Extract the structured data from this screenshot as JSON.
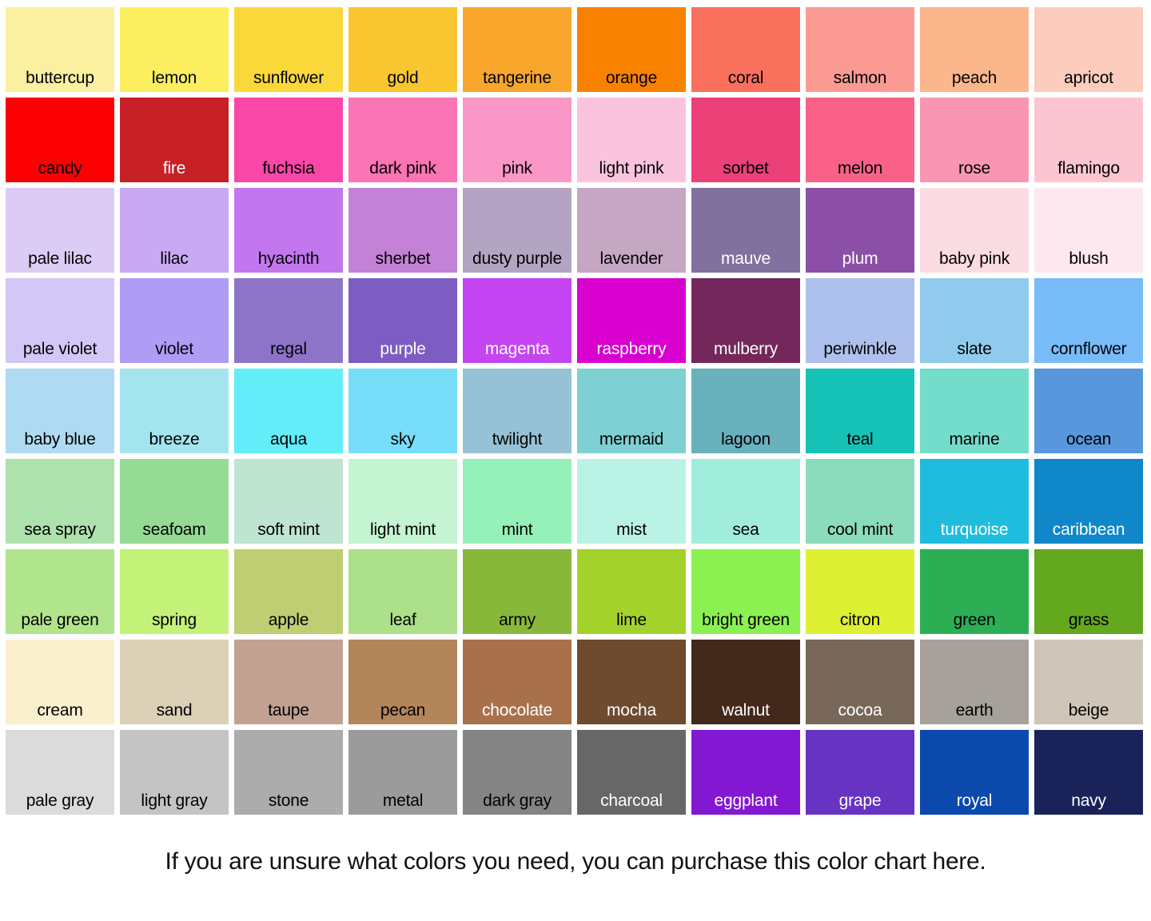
{
  "caption": "If you are unsure what colors you need, you can purchase this color chart here.",
  "grid": {
    "columns": 10,
    "rows": 9,
    "total_swatches": 90
  },
  "chart_data": {
    "type": "table",
    "title": "Color Chart",
    "columns": 10,
    "rows": 9,
    "swatches": [
      {
        "name": "buttercup",
        "hex": "#FAF0A0",
        "text": "dark"
      },
      {
        "name": "lemon",
        "hex": "#FBEE5F",
        "text": "dark"
      },
      {
        "name": "sunflower",
        "hex": "#FBD83A",
        "text": "dark"
      },
      {
        "name": "gold",
        "hex": "#FAC62F",
        "text": "dark"
      },
      {
        "name": "tangerine",
        "hex": "#F8A62C",
        "text": "dark"
      },
      {
        "name": "orange",
        "hex": "#F98100",
        "text": "dark"
      },
      {
        "name": "coral",
        "hex": "#F9705D",
        "text": "dark"
      },
      {
        "name": "salmon",
        "hex": "#FB9A93",
        "text": "dark"
      },
      {
        "name": "peach",
        "hex": "#FBB68C",
        "text": "dark"
      },
      {
        "name": "apricot",
        "hex": "#FCCCBD",
        "text": "dark"
      },
      {
        "name": "candy",
        "hex": "#FB0104",
        "text": "dark"
      },
      {
        "name": "fire",
        "hex": "#C72027",
        "text": "light"
      },
      {
        "name": "fuchsia",
        "hex": "#FB47A8",
        "text": "dark"
      },
      {
        "name": "dark pink",
        "hex": "#FB74B4",
        "text": "dark"
      },
      {
        "name": "pink",
        "hex": "#FB97C6",
        "text": "dark"
      },
      {
        "name": "light pink",
        "hex": "#FBC4DE",
        "text": "dark"
      },
      {
        "name": "sorbet",
        "hex": "#EC4079",
        "text": "dark"
      },
      {
        "name": "melon",
        "hex": "#FA6189",
        "text": "dark"
      },
      {
        "name": "rose",
        "hex": "#FA96B4",
        "text": "dark"
      },
      {
        "name": "flamingo",
        "hex": "#FCC5D2",
        "text": "dark"
      },
      {
        "name": "pale lilac",
        "hex": "#DCCCF5",
        "text": "dark"
      },
      {
        "name": "lilac",
        "hex": "#C9A9F3",
        "text": "dark"
      },
      {
        "name": "hyacinth",
        "hex": "#C277EE",
        "text": "dark"
      },
      {
        "name": "sherbet",
        "hex": "#C382D5",
        "text": "dark"
      },
      {
        "name": "dusty purple",
        "hex": "#B4A4C3",
        "text": "dark"
      },
      {
        "name": "lavender",
        "hex": "#C5A6C3",
        "text": "dark"
      },
      {
        "name": "mauve",
        "hex": "#81719F",
        "text": "light"
      },
      {
        "name": "plum",
        "hex": "#8B4FA8",
        "text": "light"
      },
      {
        "name": "baby pink",
        "hex": "#FBDCE2",
        "text": "dark"
      },
      {
        "name": "blush",
        "hex": "#FCE8EE",
        "text": "dark"
      },
      {
        "name": "pale violet",
        "hex": "#D3C7F7",
        "text": "dark"
      },
      {
        "name": "violet",
        "hex": "#AE9CF5",
        "text": "dark"
      },
      {
        "name": "regal",
        "hex": "#8E74C9",
        "text": "dark"
      },
      {
        "name": "purple",
        "hex": "#7D5DC2",
        "text": "light"
      },
      {
        "name": "magenta",
        "hex": "#C445F1",
        "text": "light"
      },
      {
        "name": "raspberry",
        "hex": "#D800CF",
        "text": "light"
      },
      {
        "name": "mulberry",
        "hex": "#73275A",
        "text": "light"
      },
      {
        "name": "periwinkle",
        "hex": "#AEC0EC",
        "text": "dark"
      },
      {
        "name": "slate",
        "hex": "#90CAEC",
        "text": "dark"
      },
      {
        "name": "cornflower",
        "hex": "#77BCF8",
        "text": "dark"
      },
      {
        "name": "baby blue",
        "hex": "#AEDBF1",
        "text": "dark"
      },
      {
        "name": "breeze",
        "hex": "#A4E4EE",
        "text": "dark"
      },
      {
        "name": "aqua",
        "hex": "#63EDF9",
        "text": "dark"
      },
      {
        "name": "sky",
        "hex": "#77DDF8",
        "text": "dark"
      },
      {
        "name": "twilight",
        "hex": "#97C2D6",
        "text": "dark"
      },
      {
        "name": "mermaid",
        "hex": "#7ED0D3",
        "text": "dark"
      },
      {
        "name": "lagoon",
        "hex": "#6AB1BE",
        "text": "dark"
      },
      {
        "name": "teal",
        "hex": "#15C2B5",
        "text": "dark"
      },
      {
        "name": "marine",
        "hex": "#74DCCB",
        "text": "dark"
      },
      {
        "name": "ocean",
        "hex": "#5897DB",
        "text": "dark"
      },
      {
        "name": "sea spray",
        "hex": "#ADE2AC",
        "text": "dark"
      },
      {
        "name": "seafoam",
        "hex": "#95DB94",
        "text": "dark"
      },
      {
        "name": "soft mint",
        "hex": "#BEE4D2",
        "text": "dark"
      },
      {
        "name": "light mint",
        "hex": "#C4F4D1",
        "text": "dark"
      },
      {
        "name": "mint",
        "hex": "#95F1BA",
        "text": "dark"
      },
      {
        "name": "mist",
        "hex": "#BAF3E5",
        "text": "dark"
      },
      {
        "name": "sea",
        "hex": "#A0EDDC",
        "text": "dark"
      },
      {
        "name": "cool mint",
        "hex": "#8BDCBD",
        "text": "dark"
      },
      {
        "name": "turquoise",
        "hex": "#20BCDE",
        "text": "light"
      },
      {
        "name": "caribbean",
        "hex": "#0F87C9",
        "text": "light"
      },
      {
        "name": "pale green",
        "hex": "#B1E58C",
        "text": "dark"
      },
      {
        "name": "spring",
        "hex": "#C4F278",
        "text": "dark"
      },
      {
        "name": "apple",
        "hex": "#BFCE72",
        "text": "dark"
      },
      {
        "name": "leaf",
        "hex": "#ACE08A",
        "text": "dark"
      },
      {
        "name": "army",
        "hex": "#88B83A",
        "text": "dark"
      },
      {
        "name": "lime",
        "hex": "#A4D22C",
        "text": "dark"
      },
      {
        "name": "bright green",
        "hex": "#8BF151",
        "text": "dark"
      },
      {
        "name": "citron",
        "hex": "#DDF032",
        "text": "dark"
      },
      {
        "name": "green",
        "hex": "#2DAE54",
        "text": "dark"
      },
      {
        "name": "grass",
        "hex": "#63A81D",
        "text": "dark"
      },
      {
        "name": "cream",
        "hex": "#FBF0CE",
        "text": "dark"
      },
      {
        "name": "sand",
        "hex": "#DCD0B7",
        "text": "dark"
      },
      {
        "name": "taupe",
        "hex": "#C2A193",
        "text": "dark"
      },
      {
        "name": "pecan",
        "hex": "#B3855B",
        "text": "dark"
      },
      {
        "name": "chocolate",
        "hex": "#A8714C",
        "text": "light"
      },
      {
        "name": "mocha",
        "hex": "#6E4A2F",
        "text": "light"
      },
      {
        "name": "walnut",
        "hex": "#43291B",
        "text": "light"
      },
      {
        "name": "cocoa",
        "hex": "#78685A",
        "text": "light"
      },
      {
        "name": "earth",
        "hex": "#A6A29B",
        "text": "dark"
      },
      {
        "name": "beige",
        "hex": "#CFC6B9",
        "text": "dark"
      },
      {
        "name": "pale gray",
        "hex": "#DBDBDB",
        "text": "dark"
      },
      {
        "name": "light gray",
        "hex": "#C4C4C4",
        "text": "dark"
      },
      {
        "name": "stone",
        "hex": "#ACACAC",
        "text": "dark"
      },
      {
        "name": "metal",
        "hex": "#9B9B9B",
        "text": "dark"
      },
      {
        "name": "dark gray",
        "hex": "#848484",
        "text": "dark"
      },
      {
        "name": "charcoal",
        "hex": "#676767",
        "text": "light"
      },
      {
        "name": "eggplant",
        "hex": "#8318D2",
        "text": "light"
      },
      {
        "name": "grape",
        "hex": "#6733C2",
        "text": "light"
      },
      {
        "name": "royal",
        "hex": "#0B49AD",
        "text": "light"
      },
      {
        "name": "navy",
        "hex": "#1A2359",
        "text": "light"
      }
    ]
  }
}
